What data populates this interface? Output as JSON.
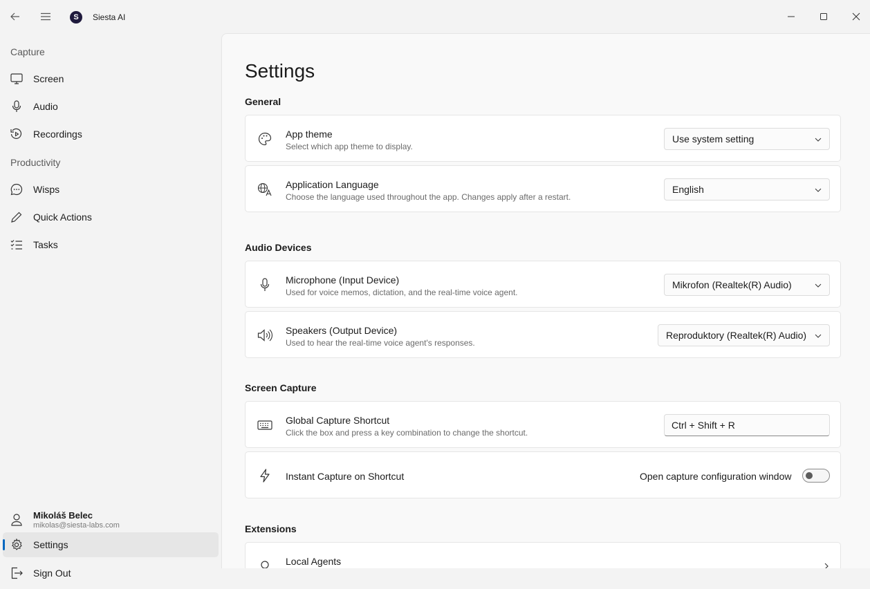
{
  "app": {
    "title": "Siesta AI",
    "logo_letter": "S"
  },
  "sidebar": {
    "sections": [
      {
        "header": "Capture",
        "items": [
          {
            "label": "Screen",
            "icon": "monitor-icon"
          },
          {
            "label": "Audio",
            "icon": "microphone-icon"
          },
          {
            "label": "Recordings",
            "icon": "recordings-icon"
          }
        ]
      },
      {
        "header": "Productivity",
        "items": [
          {
            "label": "Wisps",
            "icon": "chat-bubble-icon"
          },
          {
            "label": "Quick Actions",
            "icon": "pencil-icon"
          },
          {
            "label": "Tasks",
            "icon": "task-list-icon"
          }
        ]
      }
    ],
    "user": {
      "name": "Mikoláš Belec",
      "email": "mikolas@siesta-labs.com"
    },
    "footer": [
      {
        "label": "Settings",
        "icon": "gear-icon",
        "selected": true
      },
      {
        "label": "Sign Out",
        "icon": "sign-out-icon"
      }
    ]
  },
  "page": {
    "title": "Settings",
    "sections": {
      "general": {
        "title": "General",
        "app_theme": {
          "title": "App theme",
          "desc": "Select which app theme to display.",
          "value": "Use system setting"
        },
        "language": {
          "title": "Application Language",
          "desc": "Choose the language used throughout the app. Changes apply after a restart.",
          "value": "English"
        }
      },
      "audio": {
        "title": "Audio Devices",
        "microphone": {
          "title": "Microphone (Input Device)",
          "desc": "Used for voice memos, dictation, and the real-time voice agent.",
          "value": "Mikrofon (Realtek(R) Audio)"
        },
        "speakers": {
          "title": "Speakers (Output Device)",
          "desc": "Used to hear the real-time voice agent's responses.",
          "value": "Reproduktory (Realtek(R) Audio)"
        }
      },
      "screen": {
        "title": "Screen Capture",
        "shortcut": {
          "title": "Global Capture Shortcut",
          "desc": "Click the box and press a key combination to change the shortcut.",
          "value": "Ctrl + Shift + R"
        },
        "instant": {
          "title": "Instant Capture on Shortcut",
          "toggle_label": "Open capture configuration window",
          "on": false
        }
      },
      "extensions": {
        "title": "Extensions",
        "local_agents": {
          "title": "Local Agents"
        }
      }
    }
  }
}
